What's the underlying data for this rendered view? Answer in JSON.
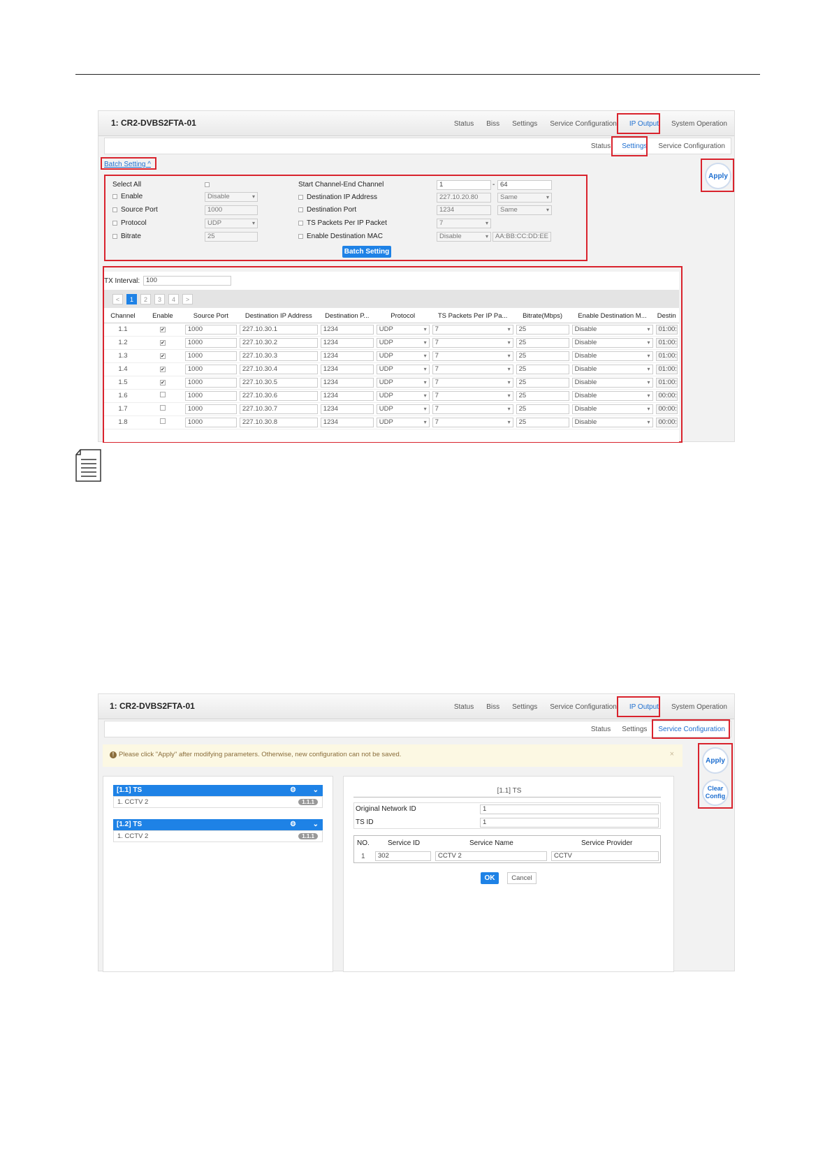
{
  "screen1": {
    "device_title": "1: CR2-DVBS2FTA-01",
    "nav_tabs": [
      "Status",
      "Biss",
      "Settings",
      "Service Configuration",
      "IP Output",
      "System Operation"
    ],
    "sub_tabs": [
      "Status",
      "Settings",
      "Service Configuration"
    ],
    "active_nav": "IP Output",
    "active_sub": "Settings",
    "apply_label": "Apply",
    "batch_link": "Batch Setting ^",
    "batch": {
      "select_all": "Select All",
      "enable": "Enable",
      "enable_value": "Disable",
      "source_port": "Source Port",
      "source_port_value": "1000",
      "protocol": "Protocol",
      "protocol_value": "UDP",
      "bitrate": "Bitrate",
      "bitrate_value": "25",
      "start_end_channel": "Start Channel-End Channel",
      "start_channel": "1",
      "channel_dash": "-",
      "end_channel": "64",
      "dest_ip": "Destination IP Address",
      "dest_ip_value": "227.10.20.80",
      "dest_ip_mode": "Same",
      "dest_port": "Destination Port",
      "dest_port_value": "1234",
      "dest_port_mode": "Same",
      "ts_packets": "TS Packets Per IP Packet",
      "ts_packets_value": "7",
      "enable_mac": "Enable Destination MAC",
      "enable_mac_value": "Disable",
      "mac_value": "AA:BB:CC:DD:EE",
      "button": "Batch Setting"
    },
    "tx_interval_label": "TX Interval:",
    "tx_interval_value": "100",
    "pager": [
      "<",
      "1",
      "2",
      "3",
      "4",
      ">"
    ],
    "columns": [
      "Channel",
      "Enable",
      "Source Port",
      "Destination IP Address",
      "Destination P...",
      "Protocol",
      "TS Packets Per IP Pa...",
      "Bitrate(Mbps)",
      "Enable Destination M...",
      "Destin"
    ],
    "rows": [
      {
        "channel": "1.1",
        "enabled": "✔",
        "src": "1000",
        "ip": "227.10.30.1",
        "port": "1234",
        "proto": "UDP",
        "ts": "7",
        "bitrate": "25",
        "mac": "Disable",
        "dest": "01:00:"
      },
      {
        "channel": "1.2",
        "enabled": "✔",
        "src": "1000",
        "ip": "227.10.30.2",
        "port": "1234",
        "proto": "UDP",
        "ts": "7",
        "bitrate": "25",
        "mac": "Disable",
        "dest": "01:00:"
      },
      {
        "channel": "1.3",
        "enabled": "✔",
        "src": "1000",
        "ip": "227.10.30.3",
        "port": "1234",
        "proto": "UDP",
        "ts": "7",
        "bitrate": "25",
        "mac": "Disable",
        "dest": "01:00:"
      },
      {
        "channel": "1.4",
        "enabled": "✔",
        "src": "1000",
        "ip": "227.10.30.4",
        "port": "1234",
        "proto": "UDP",
        "ts": "7",
        "bitrate": "25",
        "mac": "Disable",
        "dest": "01:00:"
      },
      {
        "channel": "1.5",
        "enabled": "✔",
        "src": "1000",
        "ip": "227.10.30.5",
        "port": "1234",
        "proto": "UDP",
        "ts": "7",
        "bitrate": "25",
        "mac": "Disable",
        "dest": "01:00:"
      },
      {
        "channel": "1.6",
        "enabled": "",
        "src": "1000",
        "ip": "227.10.30.6",
        "port": "1234",
        "proto": "UDP",
        "ts": "7",
        "bitrate": "25",
        "mac": "Disable",
        "dest": "00:00:"
      },
      {
        "channel": "1.7",
        "enabled": "",
        "src": "1000",
        "ip": "227.10.30.7",
        "port": "1234",
        "proto": "UDP",
        "ts": "7",
        "bitrate": "25",
        "mac": "Disable",
        "dest": "00:00:"
      },
      {
        "channel": "1.8",
        "enabled": "",
        "src": "1000",
        "ip": "227.10.30.8",
        "port": "1234",
        "proto": "UDP",
        "ts": "7",
        "bitrate": "25",
        "mac": "Disable",
        "dest": "00:00:"
      }
    ]
  },
  "screen2": {
    "device_title": "1: CR2-DVBS2FTA-01",
    "nav_tabs": [
      "Status",
      "Biss",
      "Settings",
      "Service Configuration",
      "IP Output",
      "System Operation"
    ],
    "sub_tabs": [
      "Status",
      "Settings",
      "Service Configuration"
    ],
    "active_nav": "IP Output",
    "active_sub": "Service Configuration",
    "warning_icon": "!",
    "warning": "Please click \"Apply\" after modifying parameters. Otherwise, new configuration can not be saved.",
    "warning_close": "×",
    "apply_label": "Apply",
    "clear_label": "Clear Config",
    "ts_list": [
      {
        "title": "[1.1] TS",
        "service": "1. CCTV 2",
        "badge": "1.1.1"
      },
      {
        "title": "[1.2] TS",
        "service": "1. CCTV 2",
        "badge": "1.1.1"
      }
    ],
    "detail_title": "[1.1] TS",
    "onid_label": "Original Network ID",
    "onid_value": "1",
    "tsid_label": "TS ID",
    "tsid_value": "1",
    "service_columns": [
      "NO.",
      "Service ID",
      "Service Name",
      "Service Provider"
    ],
    "service_row": {
      "no": "1",
      "id": "302",
      "name": "CCTV 2",
      "provider": "CCTV"
    },
    "ok_label": "OK",
    "cancel_label": "Cancel"
  },
  "colors": {
    "accent": "#1e82e6",
    "highlight_box": "#d9232d",
    "warning_bg": "#fcf8e3"
  },
  "icons": [
    "note-document-icon",
    "gear-icon",
    "chevron-down-icon",
    "warning-circle-icon",
    "close-icon",
    "checkbox-icon",
    "dropdown-arrow-icon"
  ]
}
